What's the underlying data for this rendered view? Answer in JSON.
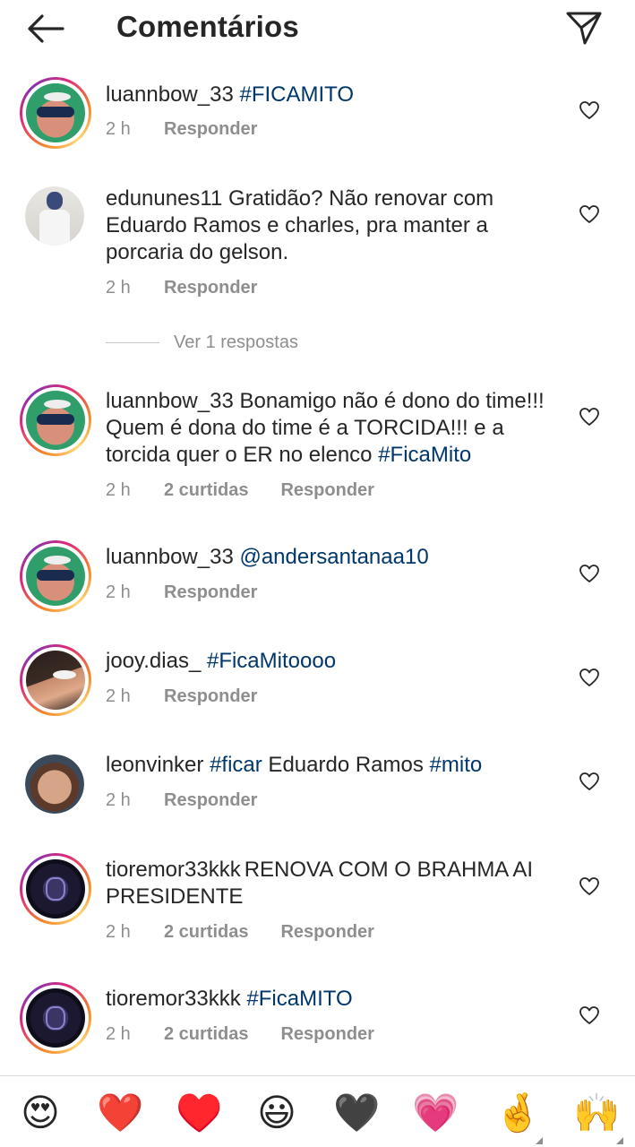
{
  "header": {
    "title": "Comentários",
    "back_icon": "arrow-left-icon",
    "send_icon": "paper-plane-icon"
  },
  "comments": [
    {
      "user": "luannbow_33",
      "parts": [
        {
          "t": "#FICAMITO",
          "tag": true
        }
      ],
      "time": "2 h",
      "likes": "",
      "reply": "Responder"
    },
    {
      "user": "edununes11",
      "parts": [
        {
          "t": "Gratidão? Não renovar com Eduardo Ramos e charles, pra manter a porcaria do gelson.",
          "tag": false
        }
      ],
      "time": "2 h",
      "likes": "",
      "reply": "Responder"
    },
    {
      "user": "luannbow_33",
      "parts": [
        {
          "t": "Bonamigo não é dono do time!!! Quem é dona do time é a TORCIDA!!! e a torcida quer o ER no elenco ",
          "tag": false
        },
        {
          "t": "#FicaMito",
          "tag": true
        }
      ],
      "time": "2 h",
      "likes": "2 curtidas",
      "reply": "Responder"
    },
    {
      "user": "luannbow_33",
      "parts": [
        {
          "t": "@andersantanaa10",
          "tag": true
        }
      ],
      "time": "2 h",
      "likes": "",
      "reply": "Responder"
    },
    {
      "user": "jooy.dias_",
      "parts": [
        {
          "t": "#FicaMitoooo",
          "tag": true
        }
      ],
      "time": "2 h",
      "likes": "",
      "reply": "Responder"
    },
    {
      "user": "leonvinker",
      "parts": [
        {
          "t": "#ficar",
          "tag": true
        },
        {
          "t": " Eduardo Ramos ",
          "tag": false
        },
        {
          "t": "#mito",
          "tag": true
        }
      ],
      "time": "2 h",
      "likes": "",
      "reply": "Responder"
    },
    {
      "user": "tioremor33kkk",
      "parts": [
        {
          "t": "RENOVA COM O BRAHMA AI PRESIDENTE",
          "tag": false
        }
      ],
      "time": "2 h",
      "likes": "2 curtidas",
      "reply": "Responder"
    },
    {
      "user": "tioremor33kkk",
      "parts": [
        {
          "t": "#FicaMITO",
          "tag": true
        }
      ],
      "time": "2 h",
      "likes": "2 curtidas",
      "reply": "Responder"
    }
  ],
  "view_replies": "Ver 1 respostas",
  "emoji_bar": [
    "😍",
    "❤️",
    "♥️",
    "😃",
    "🖤",
    "💗",
    "🤞",
    "🙌"
  ],
  "colors": {
    "hashtag": "#00376b",
    "meta": "#8e8e8e",
    "text": "#262626"
  }
}
